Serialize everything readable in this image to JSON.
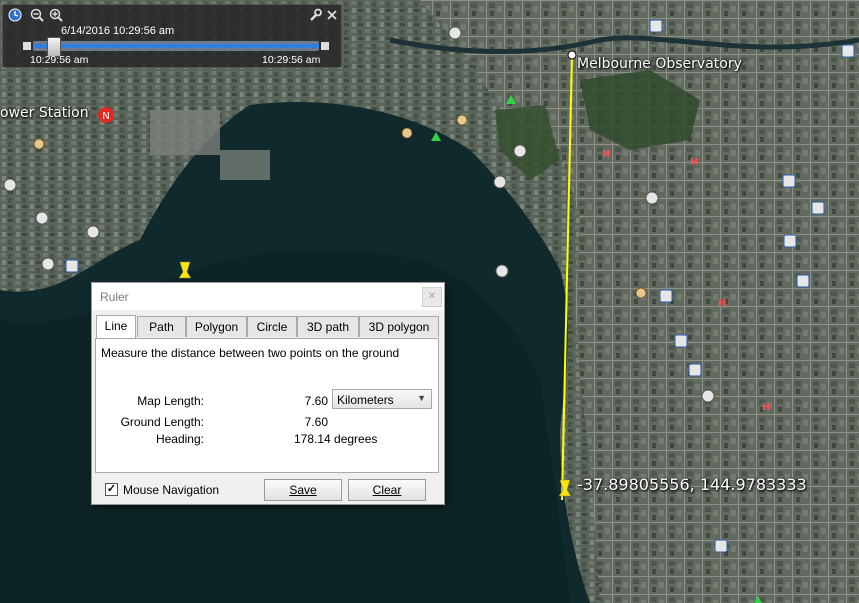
{
  "map": {
    "place_labels": {
      "observatory": "Melbourne Observatory",
      "power_station": "ower Station"
    },
    "coordinate_label": "-37.89805556, 144.9783333",
    "colors": {
      "measure_line": "#ffff00",
      "water": "#0f2a2f",
      "land": "#4e5a4a"
    }
  },
  "timebar": {
    "date_time": "6/14/2016   10:29:56 am",
    "start_time": "10:29:56 am",
    "end_time": "10:29:56 am",
    "icons": [
      "clock-icon",
      "zoom-out-icon",
      "zoom-in-icon",
      "wrench-icon",
      "close-icon"
    ]
  },
  "ruler": {
    "title": "Ruler",
    "close_label": "✕",
    "tabs": [
      "Line",
      "Path",
      "Polygon",
      "Circle",
      "3D path",
      "3D polygon"
    ],
    "active_tab": "Line",
    "description": "Measure the distance between two points on the ground",
    "map_length_label": "Map Length:",
    "map_length_value": "7.60",
    "unit": "Kilometers",
    "ground_length_label": "Ground Length:",
    "ground_length_value": "7.60",
    "heading_label": "Heading:",
    "heading_value": "178.14 degrees",
    "mouse_navigation_label": "Mouse Navigation",
    "mouse_navigation_checked": true,
    "save_label": "Save",
    "clear_label": "Clear"
  }
}
